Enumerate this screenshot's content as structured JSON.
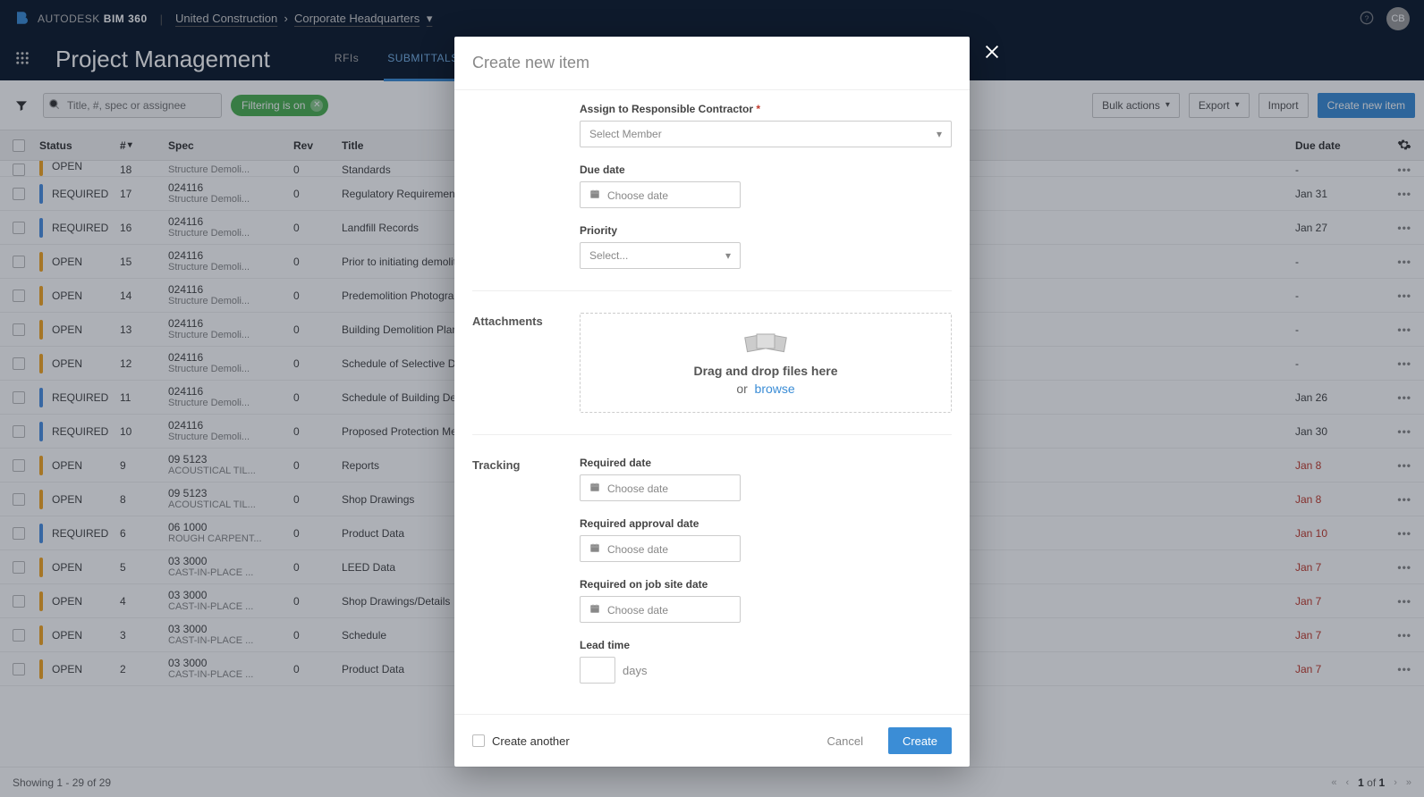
{
  "topbar": {
    "brand_autodesk": "AUTODESK",
    "brand_bim": "BIM 360",
    "crumb1": "United Construction",
    "crumb2": "Corporate Headquarters",
    "avatar_initials": "CB"
  },
  "subbar": {
    "page_title": "Project Management",
    "tabs": [
      {
        "label": "RFIs",
        "active": false
      },
      {
        "label": "SUBMITTALS",
        "active": true
      }
    ]
  },
  "toolbar": {
    "search_placeholder": "Title, #, spec or assignee",
    "filter_pill": "Filtering is on",
    "bulk_actions": "Bulk actions",
    "export": "Export",
    "import": "Import",
    "create": "Create new item"
  },
  "columns": {
    "status": "Status",
    "num": "#",
    "spec": "Spec",
    "rev": "Rev",
    "title": "Title",
    "due": "Due date"
  },
  "colors": {
    "open": "#f5a623",
    "required": "#4a90e2",
    "past_due": "#c0392b"
  },
  "rows": [
    {
      "status": "OPEN",
      "color": "open",
      "num": "18",
      "specnum": "024116",
      "specname": "Structure Demoli...",
      "rev": "0",
      "title": "Standards",
      "due": "-",
      "past": false,
      "cut": true
    },
    {
      "status": "REQUIRED",
      "color": "required",
      "num": "17",
      "specnum": "024116",
      "specname": "Structure Demoli...",
      "rev": "0",
      "title": "Regulatory Requirements",
      "due": "Jan 31",
      "past": false
    },
    {
      "status": "REQUIRED",
      "color": "required",
      "num": "16",
      "specnum": "024116",
      "specname": "Structure Demoli...",
      "rev": "0",
      "title": "Landfill Records",
      "due": "Jan 27",
      "past": false
    },
    {
      "status": "OPEN",
      "color": "open",
      "num": "15",
      "specnum": "024116",
      "specname": "Structure Demoli...",
      "rev": "0",
      "title": "Prior to initiating demolition",
      "due": "-",
      "past": false
    },
    {
      "status": "OPEN",
      "color": "open",
      "num": "14",
      "specnum": "024116",
      "specname": "Structure Demoli...",
      "rev": "0",
      "title": "Predemolition Photographs",
      "due": "-",
      "past": false
    },
    {
      "status": "OPEN",
      "color": "open",
      "num": "13",
      "specnum": "024116",
      "specname": "Structure Demoli...",
      "rev": "0",
      "title": "Building Demolition Plans",
      "due": "-",
      "past": false
    },
    {
      "status": "OPEN",
      "color": "open",
      "num": "12",
      "specnum": "024116",
      "specname": "Structure Demoli...",
      "rev": "0",
      "title": "Schedule of Selective Demo",
      "due": "-",
      "past": false
    },
    {
      "status": "REQUIRED",
      "color": "required",
      "num": "11",
      "specnum": "024116",
      "specname": "Structure Demoli...",
      "rev": "0",
      "title": "Schedule of Building Demol",
      "due": "Jan 26",
      "past": false
    },
    {
      "status": "REQUIRED",
      "color": "required",
      "num": "10",
      "specnum": "024116",
      "specname": "Structure Demoli...",
      "rev": "0",
      "title": "Proposed Protection Measu",
      "due": "Jan 30",
      "past": false
    },
    {
      "status": "OPEN",
      "color": "open",
      "num": "9",
      "specnum": "09 5123",
      "specname": "ACOUSTICAL TIL...",
      "rev": "0",
      "title": "Reports",
      "due": "Jan 8",
      "past": true
    },
    {
      "status": "OPEN",
      "color": "open",
      "num": "8",
      "specnum": "09 5123",
      "specname": "ACOUSTICAL TIL...",
      "rev": "0",
      "title": "Shop Drawings",
      "due": "Jan 8",
      "past": true
    },
    {
      "status": "REQUIRED",
      "color": "required",
      "num": "6",
      "specnum": "06 1000",
      "specname": "ROUGH CARPENT...",
      "rev": "0",
      "title": "Product Data",
      "due": "Jan 10",
      "past": true
    },
    {
      "status": "OPEN",
      "color": "open",
      "num": "5",
      "specnum": "03 3000",
      "specname": "CAST-IN-PLACE ...",
      "rev": "0",
      "title": "LEED Data",
      "due": "Jan 7",
      "past": true
    },
    {
      "status": "OPEN",
      "color": "open",
      "num": "4",
      "specnum": "03 3000",
      "specname": "CAST-IN-PLACE ...",
      "rev": "0",
      "title": "Shop Drawings/Details",
      "due": "Jan 7",
      "past": true
    },
    {
      "status": "OPEN",
      "color": "open",
      "num": "3",
      "specnum": "03 3000",
      "specname": "CAST-IN-PLACE ...",
      "rev": "0",
      "title": "Schedule",
      "due": "Jan 7",
      "past": true
    },
    {
      "status": "OPEN",
      "color": "open",
      "num": "2",
      "specnum": "03 3000",
      "specname": "CAST-IN-PLACE ...",
      "rev": "0",
      "title": "Product Data",
      "due": "Jan 7",
      "past": true
    }
  ],
  "footer": {
    "showing": "Showing 1 - 29 of 29",
    "page": "1 of 1"
  },
  "modal": {
    "title": "Create new item",
    "assign_label": "Assign to Responsible Contractor",
    "assign_placeholder": "Select Member",
    "due_label": "Due date",
    "date_placeholder": "Choose date",
    "priority_label": "Priority",
    "priority_placeholder": "Select...",
    "attachments_section": "Attachments",
    "drop_main": "Drag and drop files here",
    "drop_or": "or",
    "browse": "browse",
    "tracking_section": "Tracking",
    "required_date": "Required date",
    "required_approval_date": "Required approval date",
    "required_on_site_date": "Required on job site date",
    "lead_time": "Lead time",
    "days": "days",
    "create_another": "Create another",
    "cancel": "Cancel",
    "create": "Create"
  }
}
